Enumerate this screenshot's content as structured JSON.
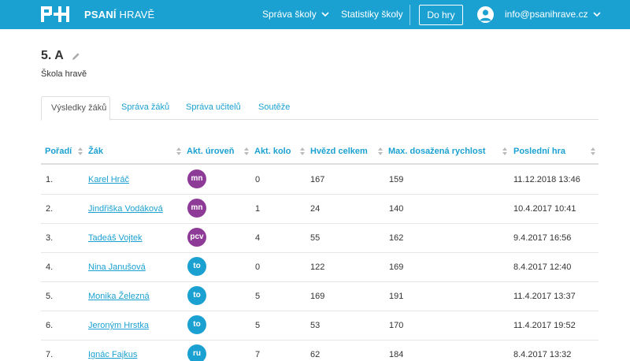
{
  "header": {
    "brand_bold": "PSANÍ",
    "brand_light": "HRAVĚ",
    "nav": [
      "Správa školy",
      "Statistiky školy"
    ],
    "play_label": "Do hry",
    "user_email": "info@psanihrave.cz",
    "accent": "#1ba1d1"
  },
  "page": {
    "class_name": "5. A",
    "school": "Škola hravě"
  },
  "tabs": [
    "Výsledky žáků",
    "Správa žáků",
    "Správa učitelů",
    "Soutěže"
  ],
  "table": {
    "columns": [
      "Pořadí",
      "Žák",
      "Akt. úroveň",
      "Akt. kolo",
      "Hvězd celkem",
      "Max. dosažená rychlost",
      "Poslední hra"
    ],
    "level_colors": {
      "mn": "#8e3a97",
      "pcv": "#8e3a97",
      "to": "#1ba1d1",
      "ru": "#1ba1d1"
    },
    "rows": [
      {
        "rank": "1.",
        "name": "Karel Hráč",
        "level": "mn",
        "round": "0",
        "stars": "167",
        "speed": "159",
        "last": "11.12.2018 13:46"
      },
      {
        "rank": "2.",
        "name": "Jindřiška Vodáková",
        "level": "mn",
        "round": "1",
        "stars": "24",
        "speed": "140",
        "last": "10.4.2017 10:41"
      },
      {
        "rank": "3.",
        "name": "Tadeáš Vojtek",
        "level": "pcv",
        "round": "4",
        "stars": "55",
        "speed": "162",
        "last": "9.4.2017 16:56"
      },
      {
        "rank": "4.",
        "name": "Nina Janušová",
        "level": "to",
        "round": "0",
        "stars": "122",
        "speed": "169",
        "last": "8.4.2017 12:40"
      },
      {
        "rank": "5.",
        "name": "Monika Železná",
        "level": "to",
        "round": "5",
        "stars": "169",
        "speed": "191",
        "last": "11.4.2017 13:37"
      },
      {
        "rank": "6.",
        "name": "Jeroným Hrstka",
        "level": "to",
        "round": "5",
        "stars": "53",
        "speed": "170",
        "last": "11.4.2017 19:52"
      },
      {
        "rank": "7.",
        "name": "Ignác Fajkus",
        "level": "ru",
        "round": "7",
        "stars": "62",
        "speed": "184",
        "last": "8.4.2017 13:32"
      }
    ]
  }
}
